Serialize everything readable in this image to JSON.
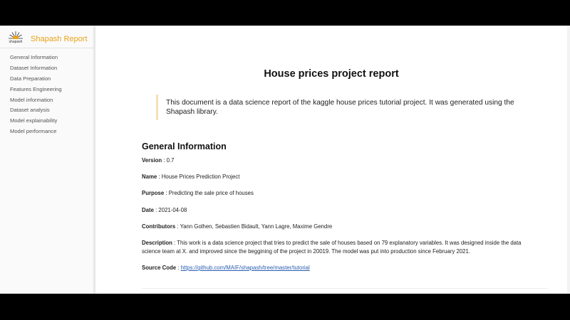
{
  "brand": {
    "title": "Shapash Report",
    "logo_icon": "shapash-logo-icon",
    "accent_color": "#e8a317"
  },
  "sidebar": {
    "items": [
      {
        "label": "General Information"
      },
      {
        "label": "Dataset Information"
      },
      {
        "label": "Data Preparation"
      },
      {
        "label": "Features Engineering"
      },
      {
        "label": "Model information"
      },
      {
        "label": "Dataset analysis"
      },
      {
        "label": "Model explainability"
      },
      {
        "label": "Model performance"
      }
    ]
  },
  "report": {
    "title": "House prices project report",
    "intro": "This document is a data science report of the kaggle house prices tutorial project. It was generated using the Shapash library.",
    "section_title": "General Information",
    "fields": [
      {
        "label": "Version",
        "value": "0.7"
      },
      {
        "label": "Name",
        "value": "House Prices Prediction Project"
      },
      {
        "label": "Purpose",
        "value": "Predicting the sale price of houses"
      },
      {
        "label": "Date",
        "value": "2021-04-08"
      },
      {
        "label": "Contributors",
        "value": "Yann Golhen, Sebastien Bidault, Yann Lagre, Maxime Gendre"
      },
      {
        "label": "Description",
        "value": "This work is a data science project that tries to predict the sale of houses based on 79 explanatory variables. It was designed inside the data science team at X. and improved since the beggining of the project in 20019. The model was put into production since February 2021."
      },
      {
        "label": "Source Code",
        "value": "https://github.com/MAIF/shapash/tree/master/tutorial"
      }
    ]
  }
}
